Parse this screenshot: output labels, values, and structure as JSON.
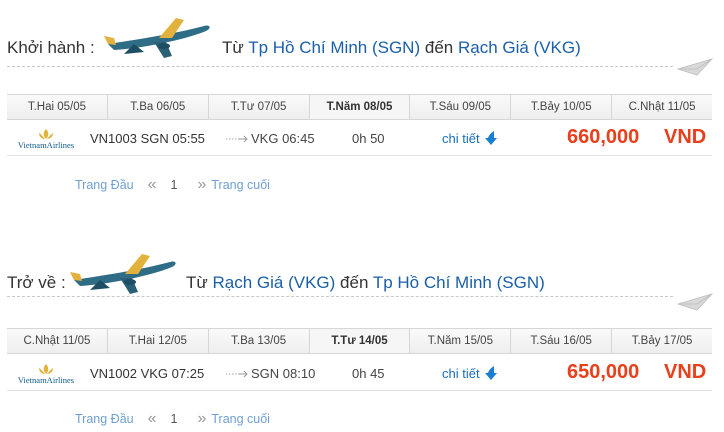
{
  "outbound": {
    "leg_label": "Khởi hành :",
    "route_from_word": "Từ",
    "route_from": "Tp Hồ Chí Minh (SGN)",
    "route_to_word": "đến",
    "route_to": "Rạch Giá (VKG)",
    "dates": [
      "T.Hai 05/05",
      "T.Ba 06/05",
      "T.Tư 07/05",
      "T.Năm 08/05",
      "T.Sáu 09/05",
      "T.Bảy 10/05",
      "C.Nhật 11/05"
    ],
    "active_date_index": 3,
    "flight": {
      "airline": "VietnamAirlines",
      "departure": "VN1003 SGN 05:55",
      "arrival": "VKG 06:45",
      "duration": "0h 50",
      "detail_label": "chi tiết",
      "price": "660,000",
      "currency": "VND"
    },
    "pager": {
      "first": "Trang Đầu",
      "prev": "«",
      "page": "1",
      "next": "»",
      "last": "Trang cuối"
    }
  },
  "return": {
    "leg_label": "Trở về :",
    "route_from_word": "Từ",
    "route_from": "Rạch Giá (VKG)",
    "route_to_word": "đến",
    "route_to": "Tp Hồ Chí Minh (SGN)",
    "dates": [
      "C.Nhật 11/05",
      "T.Hai 12/05",
      "T.Ba 13/05",
      "T.Tư 14/05",
      "T.Năm 15/05",
      "T.Sáu 16/05",
      "T.Bảy 17/05"
    ],
    "active_date_index": 3,
    "flight": {
      "airline": "VietnamAirlines",
      "departure": "VN1002 VKG 07:25",
      "arrival": "SGN 08:10",
      "duration": "0h 45",
      "detail_label": "chi tiết",
      "price": "650,000",
      "currency": "VND"
    },
    "pager": {
      "first": "Trang Đầu",
      "prev": "«",
      "page": "1",
      "next": "»",
      "last": "Trang cuối"
    }
  },
  "colors": {
    "link": "#1a5fa8",
    "price": "#e8401c",
    "pager": "#6e9fd1"
  },
  "icons": [
    "airplane-photo-icon",
    "paper-plane-icon",
    "flight-arrow-icon",
    "down-arrow-icon",
    "vietnam-airlines-lotus-icon"
  ]
}
